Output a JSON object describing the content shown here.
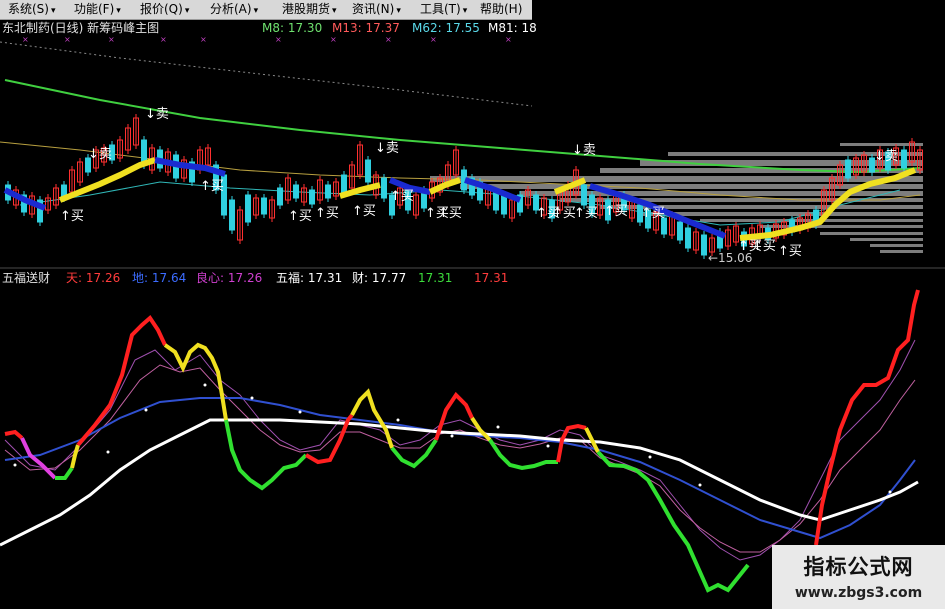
{
  "menu": [
    {
      "label": "系统(S)"
    },
    {
      "label": "功能(F)"
    },
    {
      "label": "报价(Q)"
    },
    {
      "label": "分析(A)"
    },
    {
      "label": "港股期货"
    },
    {
      "label": "资讯(N)"
    },
    {
      "label": "工具(T)"
    },
    {
      "label": "帮助(H)"
    }
  ],
  "main_chart": {
    "title": "东北制药(日线)  新筹码峰主图",
    "ma_labels": [
      {
        "text": "M8: 17.30",
        "color": "#6ee06e"
      },
      {
        "text": "M13: 17.37",
        "color": "#ff5a5a"
      },
      {
        "text": "M62: 17.55",
        "color": "#5ad8e8"
      },
      {
        "text": "M81: 18",
        "color": "#ffffff"
      }
    ],
    "signals_buy": "↑买",
    "signals_sell": "↓卖",
    "low_price_label": "←15.06"
  },
  "indicator": {
    "name": "五福送财",
    "values": [
      {
        "text": "天: 17.26",
        "color": "#ff3c3c"
      },
      {
        "text": "地: 17.64",
        "color": "#3c6cff"
      },
      {
        "text": "良心: 17.26",
        "color": "#d040d0"
      },
      {
        "text": "五福: 17.31",
        "color": "#ffffff"
      },
      {
        "text": "财: 17.77",
        "color": "#ffffff"
      },
      {
        "text": "17.31",
        "color": "#3cdc3c"
      },
      {
        "text": "17.31",
        "color": "#ff3c3c"
      }
    ]
  },
  "watermark": {
    "title": "指标公式网",
    "url": "www.zbgs3.com"
  },
  "colors": {
    "up_candle": "#ff3030",
    "down_candle": "#30d0e0",
    "long_ma": "#40d040",
    "ribbon_yellow": "#f0e020",
    "ribbon_blue": "#1a2ad0",
    "chip_bars": "#808080"
  }
}
